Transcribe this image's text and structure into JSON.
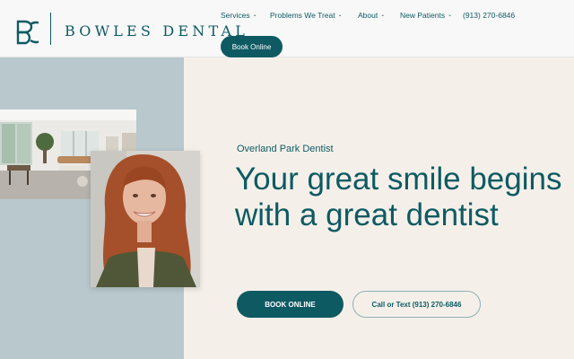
{
  "brand": {
    "name": "BOWLES DENTAL",
    "color": "#0e5a63"
  },
  "nav": {
    "items": [
      {
        "label": "Services",
        "has_dropdown": true
      },
      {
        "label": "Problems We Treat",
        "has_dropdown": true
      },
      {
        "label": "About",
        "has_dropdown": true
      },
      {
        "label": "New Patients",
        "has_dropdown": true
      }
    ],
    "phone": "(913) 270-6846",
    "book_label": "Book Online"
  },
  "hero": {
    "eyebrow": "Overland Park Dentist",
    "headline": "Your great smile begins with a great dentist",
    "cta_primary": "BOOK ONLINE",
    "cta_secondary": "Call or Text (913) 270-6846"
  },
  "icons": {
    "logo": "bd-monogram-icon",
    "dropdown": "chevron-down-icon"
  },
  "colors": {
    "header_bg": "#f8f8f8",
    "hero_bg": "#f4f0e9",
    "side_panel": "#b8c8cc"
  }
}
